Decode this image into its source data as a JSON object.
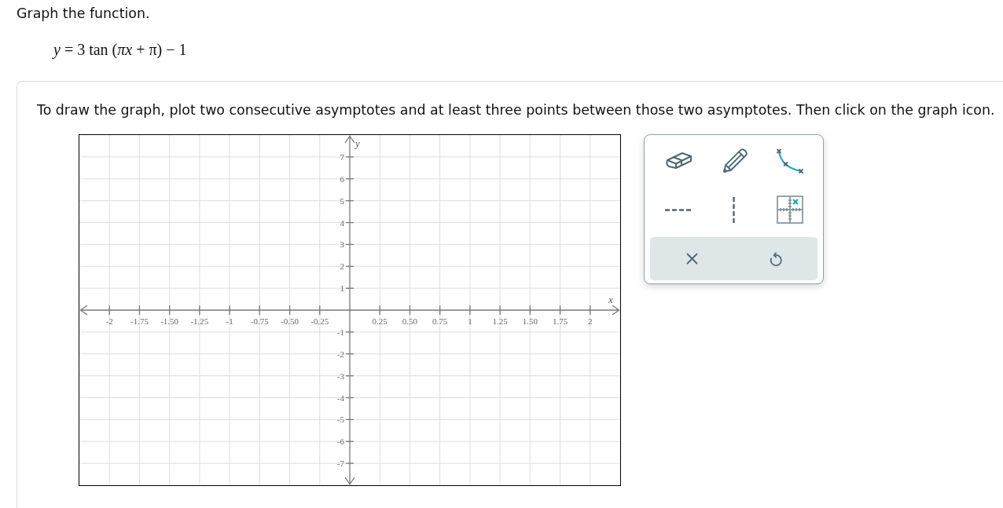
{
  "prompt": "Graph the function.",
  "equation": "*y* = 3 tan (*πx* + π) − 1",
  "card": {
    "instruction": "To draw the graph, plot two consecutive asymptotes and at least three points between those two asymptotes. Then click on the graph icon.",
    "graph": {
      "chart_data": {
        "type": "line",
        "xlabel": "x",
        "ylabel": "y",
        "xlim": [
          -2.25,
          2.25
        ],
        "ylim": [
          -8,
          8
        ],
        "grid": true,
        "xticks": [
          -2,
          -1.75,
          {
            "value": -1.5,
            "label": "-1.50"
          },
          -1.25,
          -1,
          -0.75,
          {
            "value": -0.5,
            "label": "-0.50"
          },
          -0.25,
          0.25,
          {
            "value": 0.5,
            "label": "0.50"
          },
          0.75,
          1,
          1.25,
          {
            "value": 1.5,
            "label": "1.50"
          },
          1.75,
          2
        ],
        "yticks": [
          -7,
          -6,
          -5,
          -4,
          -3,
          -2,
          -1,
          1,
          2,
          3,
          4,
          5,
          6,
          7
        ]
      }
    }
  }
}
